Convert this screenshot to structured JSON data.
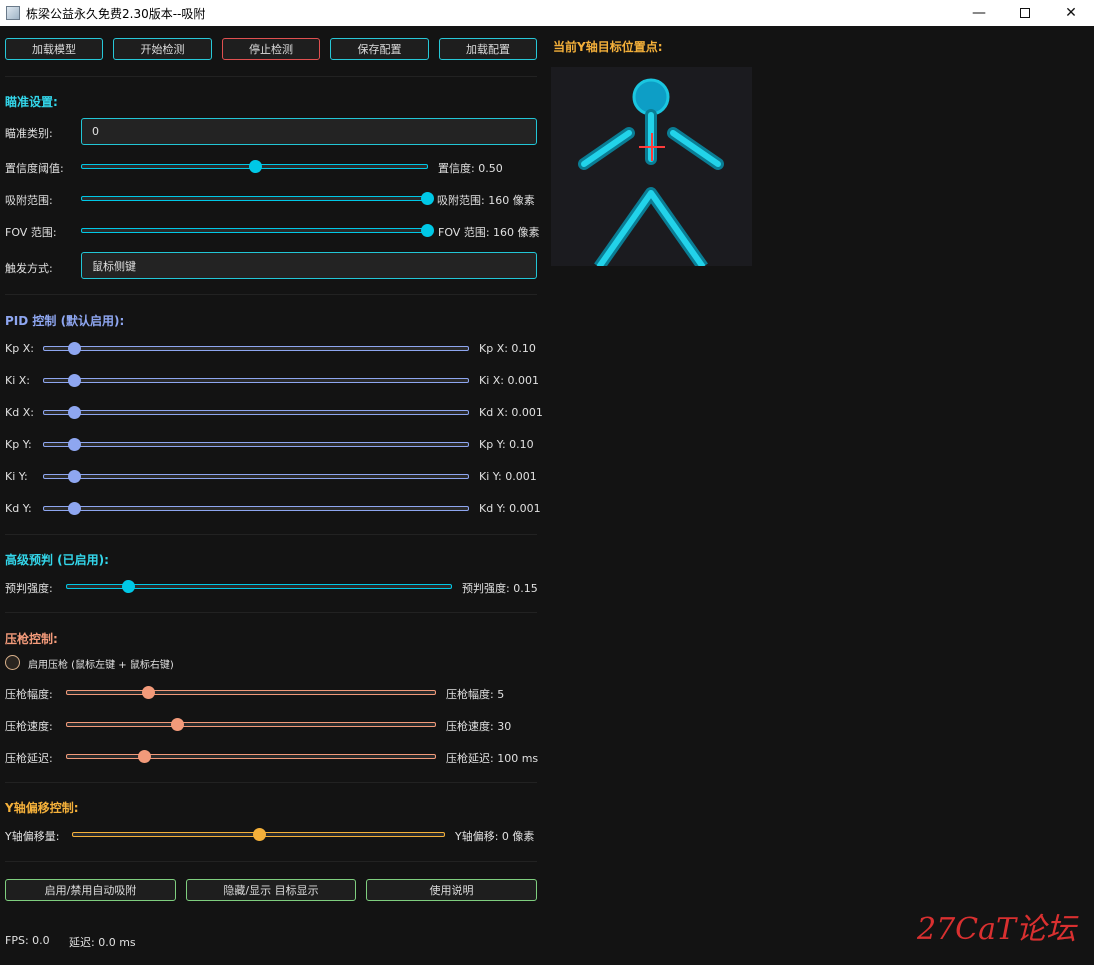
{
  "window": {
    "title": "栋梁公益永久免费2.30版本--吸附",
    "min_icon": "minimize-icon",
    "max_icon": "maximize-icon",
    "close_icon": "close-icon"
  },
  "toolbar": {
    "load_model": "加载模型",
    "start_detect": "开始检测",
    "stop_detect": "停止检测",
    "save_config": "保存配置",
    "load_config": "加载配置"
  },
  "aim": {
    "title": "瞄准设置:",
    "category_label": "瞄准类别:",
    "category_value": "0",
    "confidence_label": "置信度阈值:",
    "confidence_value_text": "置信度: 0.50",
    "confidence": 0.5,
    "snap_label": "吸附范围:",
    "snap_value_text": "吸附范围: 160 像素",
    "snap_fraction": 1.0,
    "fov_label": "FOV 范围:",
    "fov_value_text": "FOV 范围: 160 像素",
    "fov_fraction": 1.0,
    "trigger_label": "触发方式:",
    "trigger_value": "鼠标侧键"
  },
  "pid": {
    "title": "PID 控制 (默认启用):",
    "rows": [
      {
        "label": "Kp X:",
        "value_text": "Kp X: 0.10",
        "fraction": 0.07
      },
      {
        "label": "Ki X:",
        "value_text": "Ki X: 0.001",
        "fraction": 0.07
      },
      {
        "label": "Kd X:",
        "value_text": "Kd X: 0.001",
        "fraction": 0.07
      },
      {
        "label": "Kp Y:",
        "value_text": "Kp Y: 0.10",
        "fraction": 0.07
      },
      {
        "label": "Ki Y:",
        "value_text": "Ki Y: 0.001",
        "fraction": 0.07
      },
      {
        "label": "Kd Y:",
        "value_text": "Kd Y: 0.001",
        "fraction": 0.07
      }
    ]
  },
  "predict": {
    "title": "高级预判 (已启用):",
    "label": "预判强度:",
    "value_text": "预判强度: 0.15",
    "fraction": 0.16
  },
  "recoil": {
    "title": "压枪控制:",
    "enable_label": "启用压枪 (鼠标左键 + 鼠标右键)",
    "enabled": false,
    "rows": [
      {
        "label": "压枪幅度:",
        "value_text": "压枪幅度: 5",
        "fraction": 0.22
      },
      {
        "label": "压枪速度:",
        "value_text": "压枪速度: 30",
        "fraction": 0.3
      },
      {
        "label": "压枪延迟:",
        "value_text": "压枪延迟: 100 ms",
        "fraction": 0.21
      }
    ]
  },
  "yoffset": {
    "title": "Y轴偏移控制:",
    "label": "Y轴偏移量:",
    "value_text": "Y轴偏移: 0 像素",
    "fraction": 0.5
  },
  "bottom": {
    "toggle_snap": "启用/禁用自动吸附",
    "toggle_target": "隐藏/显示 目标显示",
    "help": "使用说明"
  },
  "status": {
    "fps": "FPS: 0.0",
    "latency": "延迟: 0.0 ms"
  },
  "preview": {
    "title": "当前Y轴目标位置点:"
  },
  "watermark": "27CaT论坛",
  "colors": {
    "cyan": "#00c8e6",
    "periwinkle": "#8ea6f0",
    "salmon": "#f29a7a",
    "gold": "#f4b03a"
  }
}
